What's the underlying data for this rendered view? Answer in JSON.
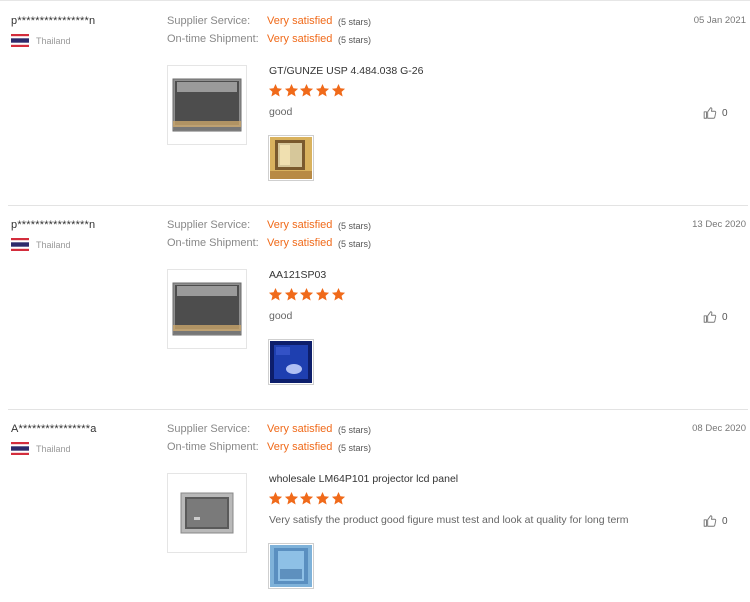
{
  "labels": {
    "supplier_service": "Supplier Service:",
    "ontime_shipment": "On-time Shipment:"
  },
  "colors": {
    "accent": "#f06a1a",
    "star": "#f06a1a",
    "divider": "#e3e3e3"
  },
  "reviews": [
    {
      "buyer": "p****************n",
      "country": "Thailand",
      "date": "05 Jan 2021",
      "supplier_service": "Very satisfied",
      "supplier_stars_text": "(5 stars)",
      "shipment": "Very satisfied",
      "shipment_stars_text": "(5 stars)",
      "product": "GT/GUNZE USP 4.484.038 G-26",
      "rating": 5,
      "comment": "good",
      "likes": "0"
    },
    {
      "buyer": "p****************n",
      "country": "Thailand",
      "date": "13 Dec 2020",
      "supplier_service": "Very satisfied",
      "supplier_stars_text": "(5 stars)",
      "shipment": "Very satisfied",
      "shipment_stars_text": "(5 stars)",
      "product": "AA121SP03",
      "rating": 5,
      "comment": "good",
      "likes": "0"
    },
    {
      "buyer": "A****************a",
      "country": "Thailand",
      "date": "08 Dec 2020",
      "supplier_service": "Very satisfied",
      "supplier_stars_text": "(5 stars)",
      "shipment": "Very satisfied",
      "shipment_stars_text": "(5 stars)",
      "product": "wholesale LM64P101 projector lcd panel",
      "rating": 5,
      "comment": "Very satisfy the product good figure must test and look at quality for long term",
      "likes": "0"
    }
  ]
}
